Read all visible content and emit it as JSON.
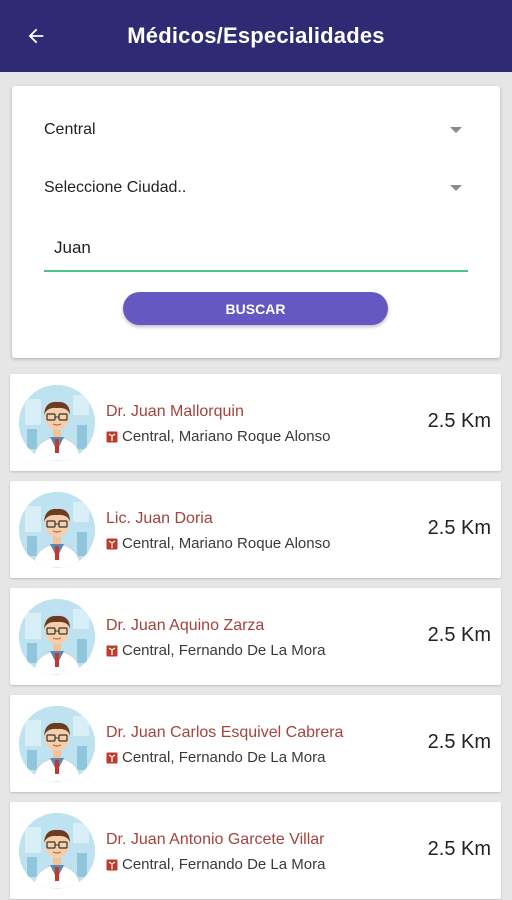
{
  "header": {
    "title": "Médicos/Especialidades",
    "back_icon": "arrow-left-icon",
    "background": "#2e2a73"
  },
  "search": {
    "department_value": "Central",
    "city_placeholder": "Seleccione Ciudad..",
    "name_value": "Juan",
    "button_label": "BUSCAR",
    "button_color": "#6658c3",
    "input_underline_color": "#4cc38a"
  },
  "results": [
    {
      "name": "Dr. Juan Mallorquin",
      "location": "Central, Mariano Roque Alonso",
      "distance": "2.5 Km"
    },
    {
      "name": "Lic. Juan Doria",
      "location": "Central, Mariano Roque Alonso",
      "distance": "2.5 Km"
    },
    {
      "name": "Dr. Juan Aquino Zarza",
      "location": "Central, Fernando De La Mora",
      "distance": "2.5 Km"
    },
    {
      "name": "Dr. Juan Carlos Esquivel Cabrera",
      "location": "Central, Fernando De La Mora",
      "distance": "2.5 Km"
    },
    {
      "name": "Dr. Juan Antonio Garcete Villar",
      "location": "Central, Fernando De La Mora",
      "distance": "2.5 Km"
    }
  ],
  "colors": {
    "name_text": "#a4433c",
    "pin_icon": "#c0392b"
  }
}
